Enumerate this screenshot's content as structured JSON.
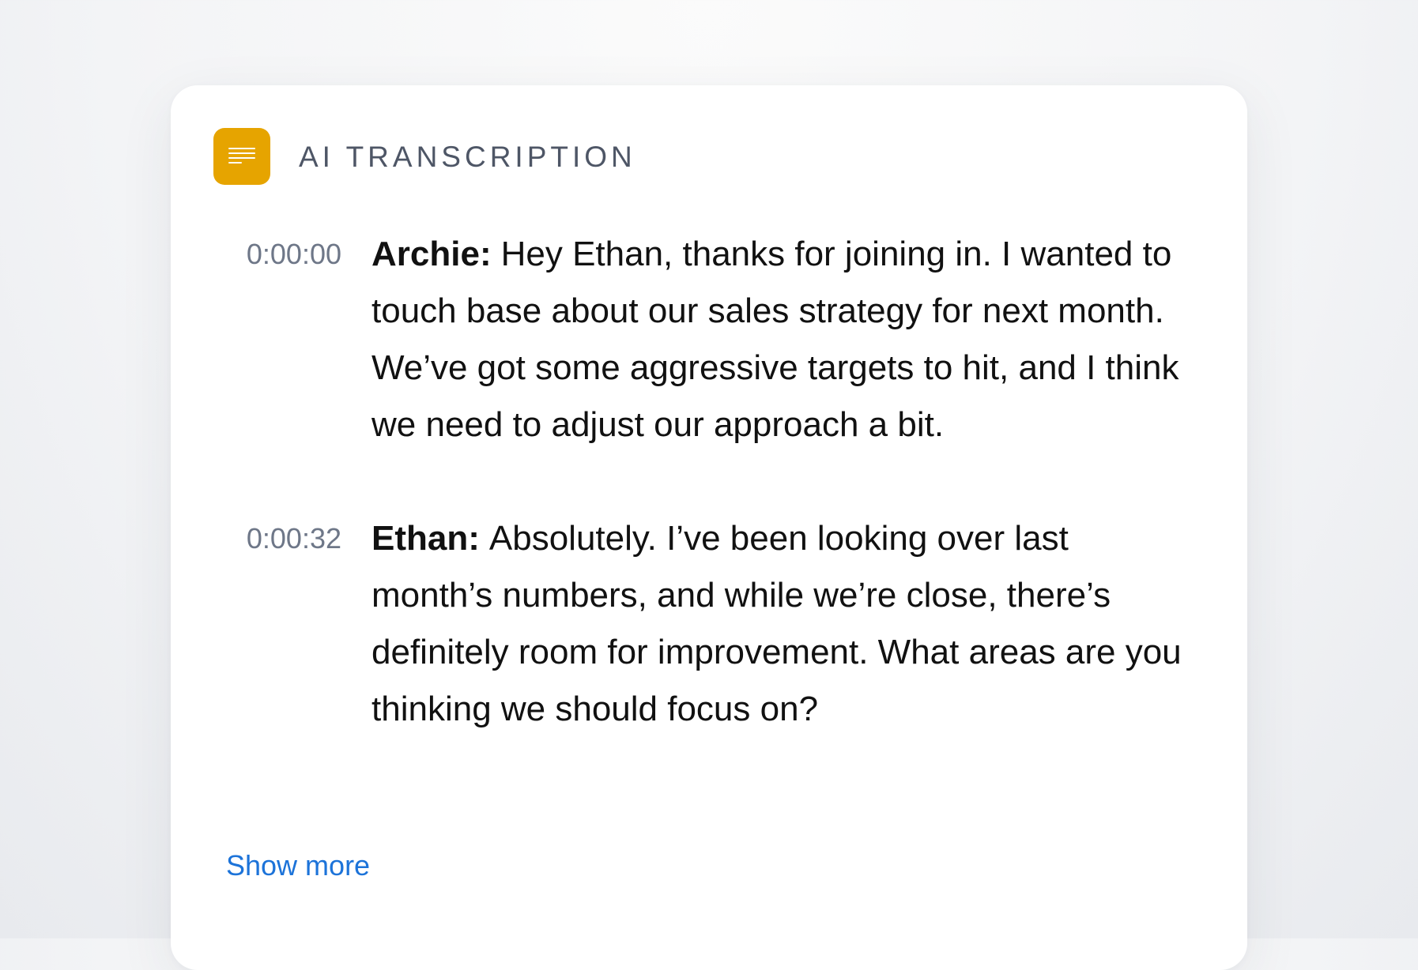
{
  "panel": {
    "title": "AI TRANSCRIPTION",
    "icon": "document-lines-icon",
    "accent_color": "#e6a400",
    "link_color": "#1c73d9"
  },
  "transcript": [
    {
      "timestamp": "0:00:00",
      "speaker": "Archie:",
      "text": "Hey Ethan, thanks for joining in. I wanted to touch base about our sales strategy for next month. We’ve got some aggressive targets to hit, and I think we need to adjust our approach a bit."
    },
    {
      "timestamp": "0:00:32",
      "speaker": "Ethan:",
      "text": "Absolutely. I’ve been looking over last month’s numbers, and while we’re close, there’s definitely room for improvement. What areas are you thinking we should focus on?"
    }
  ],
  "actions": {
    "show_more": "Show more"
  }
}
